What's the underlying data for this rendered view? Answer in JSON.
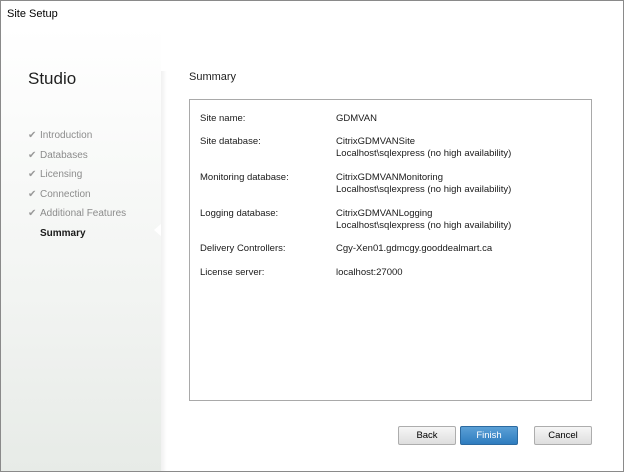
{
  "window": {
    "title": "Site Setup"
  },
  "sidebar": {
    "title": "Studio",
    "steps": [
      {
        "label": "Introduction",
        "completed": true
      },
      {
        "label": "Databases",
        "completed": true
      },
      {
        "label": "Licensing",
        "completed": true
      },
      {
        "label": "Connection",
        "completed": true
      },
      {
        "label": "Additional Features",
        "completed": true
      },
      {
        "label": "Summary",
        "completed": false,
        "active": true
      }
    ],
    "check_glyph": "✔"
  },
  "main": {
    "title": "Summary",
    "rows": [
      {
        "label": "Site name:",
        "value": [
          "GDMVAN"
        ]
      },
      {
        "label": "Site database:",
        "value": [
          "CitrixGDMVANSite",
          "Localhost\\sqlexpress (no high availability)"
        ]
      },
      {
        "label": "Monitoring database:",
        "value": [
          "CitrixGDMVANMonitoring",
          "Localhost\\sqlexpress (no high availability)"
        ]
      },
      {
        "label": "Logging database:",
        "value": [
          "CitrixGDMVANLogging",
          "Localhost\\sqlexpress (no high availability)"
        ]
      },
      {
        "label": "Delivery Controllers:",
        "value": [
          "Cgy-Xen01.gdmcgy.gooddealmart.ca"
        ]
      },
      {
        "label": "License server:",
        "value": [
          "localhost:27000"
        ]
      }
    ]
  },
  "buttons": {
    "back": "Back",
    "finish": "Finish",
    "cancel": "Cancel"
  },
  "colors": {
    "primary_button": "#2e7cbf",
    "sidebar_bg": "#f2f4f2"
  }
}
